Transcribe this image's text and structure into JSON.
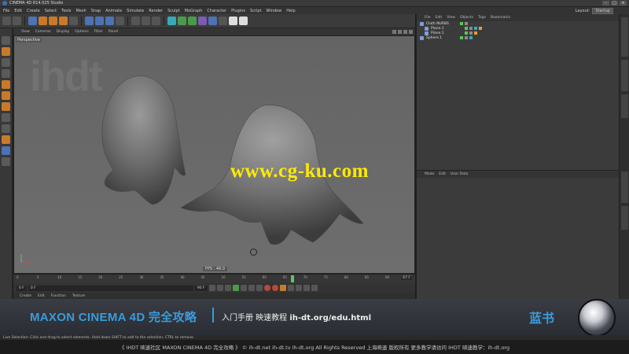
{
  "window": {
    "title": "CINEMA 4D R14.025 Studio"
  },
  "menubar": {
    "items": [
      "File",
      "Edit",
      "Create",
      "Select",
      "Tools",
      "Mesh",
      "Snap",
      "Animate",
      "Simulate",
      "Render",
      "Sculpt",
      "MoGraph",
      "Character",
      "Plugins",
      "Script",
      "Window",
      "Help"
    ],
    "layout_label": "Layout:",
    "layout_value": "Startup"
  },
  "viewport": {
    "menu": [
      "View",
      "Cameras",
      "Display",
      "Options",
      "Filter",
      "Panel"
    ],
    "camera_label": "Perspective",
    "fps": "FPS : 46.0",
    "overlay_watermark": "www.cg-ku.com",
    "bg_logo": "ihdt"
  },
  "timeline": {
    "ticks": [
      "0",
      "5",
      "10",
      "15",
      "20",
      "25",
      "30",
      "35",
      "40",
      "45",
      "50",
      "55",
      "60",
      "65",
      "70",
      "75",
      "80",
      "85",
      "90"
    ],
    "playhead_frame": 67,
    "current_frame": "67 F",
    "start_field": "0 F",
    "min_field": "0 F",
    "end_field": "90 F"
  },
  "materials": {
    "menu": [
      "Create",
      "Edit",
      "Function",
      "Texture"
    ]
  },
  "object_manager": {
    "menu": [
      "File",
      "Edit",
      "View",
      "Objects",
      "Tags",
      "Bookmarks"
    ],
    "objects": [
      {
        "name": "Cloth NURBS",
        "indent": false
      },
      {
        "name": "Plane.1",
        "indent": true
      },
      {
        "name": "Plane.1",
        "indent": true
      },
      {
        "name": "Sphere.1",
        "indent": false
      }
    ]
  },
  "attribute_manager": {
    "menu": [
      "Mode",
      "Edit",
      "User Data"
    ]
  },
  "banner": {
    "title": "MAXON CINEMA 4D 完全攻略",
    "subtitle": "入门手册 映速教程 ",
    "url": "ih-dt.org/edu.html",
    "right_text": "蓝书"
  },
  "statusbar": {
    "text": "Live Selection: Click and drag to select elements. Hold down SHIFT to add to the selection, CTRL to remove."
  },
  "footer": {
    "text": "《 IHDT 映速社区 MAXON CINEMA 4D 完全攻略 》 © ih-dt.net ih-dt.tv  ih-dt.org  All Rights Reserved 上海映速 版权所有     更多教学请访问 IHDT 映速教学：ih-dt.org"
  }
}
